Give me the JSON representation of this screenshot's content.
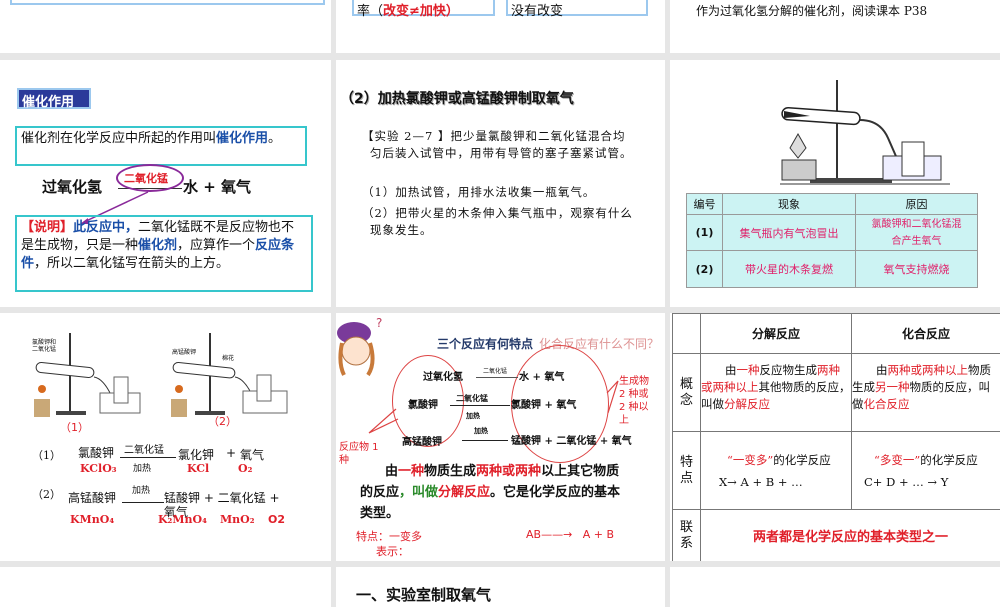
{
  "slides_top": {
    "s2_box1": "率（改变≠加快）",
    "s2_box1_a": "率",
    "s2_box1_b": "（改变≠加快）",
    "s2_box2": "没有改变",
    "s3_text": "作为过氧化氢分解的催化剂，阅读课本 P38"
  },
  "catalysis": {
    "title": "催化作用",
    "def_a": "催化剂在化学反应中所起的作用叫",
    "def_b": "催化作用",
    "def_c": "。",
    "eq_left": "过氧化氢",
    "eq_cond": "二氧化锰",
    "eq_right": "水 + 氧气",
    "note_tag": "【说明】",
    "note_blue1": "此反应中，",
    "note_1": "二氧化锰既不是反应物也不是生成物，只是一种",
    "note_blue2": "催化剂",
    "note_2": "，应算作一个",
    "note_blue3": "反应条件",
    "note_3": "，所以二氧化锰写在箭头的上方。"
  },
  "experiment": {
    "heading": "（2）加热氯酸钾或高锰酸钾制取氧气",
    "p1": "【实验 2—7 】把少量氯酸钾和二氧化锰混合均匀后装入试管中，用带有导管的塞子塞紧试管。",
    "p2": "（1）加热试管，用排水法收集一瓶氧气。",
    "p3": "（2）把带火星的木条伸入集气瓶中，观察有什么现象发生。"
  },
  "results_table": {
    "headers": [
      "编号",
      "现象",
      "原因"
    ],
    "rows": [
      [
        "(1)",
        "集气瓶内有气泡冒出",
        "氯酸钾和二氧化锰混合产生氧气"
      ],
      [
        "(2)",
        "带火星的木条复燃",
        "氧气支持燃烧"
      ]
    ]
  },
  "equations": {
    "label1_img": "氯酸钾和二氧化锰",
    "label2_img": "高锰酸钾",
    "label2_cotton": "棉花",
    "fig1": "（1）",
    "fig2": "（2）",
    "r1_no": "（1）",
    "r1_reactant": "氯酸钾",
    "r1_cond_top": "二氧化锰",
    "r1_cond_bottom": "加热",
    "r1_p1": "氯化钾",
    "r1_plus": "+",
    "r1_p2": "氧气",
    "r1_f_reactant": "KClO₃",
    "r1_f_p1": "KCl",
    "r1_f_p2": "O₂",
    "r2_no": "（2）",
    "r2_reactant": "高锰酸钾",
    "r2_cond": "加热",
    "r2_products": "锰酸钾 + 二氧化锰 + 氧气",
    "r2_f_reactant": "KMnO₄",
    "r2_f_p1": "K₂MnO₄",
    "r2_f_p2": "MnO₂",
    "r2_f_p3": "O2"
  },
  "decomposition": {
    "title_a": "三个反应有何特点",
    "title_b": "化合反应有什么不同？",
    "eq1_l": "过氧化氢",
    "eq1_c": "二氧化锰",
    "eq1_r": "水 + 氧气",
    "eq2_l": "氯酸钾",
    "eq2_c": "二氧化锰",
    "eq2_c2": "加热",
    "eq2_r": "氯酸钾 + 氧气",
    "eq3_l": "高锰酸钾",
    "eq3_c": "加热",
    "eq3_r": "锰酸钾 + 二氧化锰 + 氧气",
    "note_left": "反应物 1 种",
    "note_right": "生成物 2 种或 2 种以上",
    "def_1": "由",
    "def_2": "一种",
    "def_3": "物质生成",
    "def_4": "两种或两种",
    "def_5": "以上其它物质的反应",
    "def_6": "，叫做",
    "def_7": "分解反应",
    "def_8": "。它是化学反应的基本类型。",
    "feature": "特点：一变多",
    "express": "表示：",
    "formula": "AB——→   A + B"
  },
  "compare_table": {
    "headers": [
      "",
      "分解反应",
      "化合反应"
    ],
    "row_labels": [
      "概念",
      "特点",
      "联系"
    ],
    "concept_decomp": [
      "由",
      "一种",
      "反应物生成",
      "两种或两种以上",
      "其他物质的反应，叫做",
      "分解反应"
    ],
    "concept_comb": [
      "由",
      "两种或两种以上",
      "物质生成",
      "另一种",
      "物质的反应，叫做",
      "化合反应"
    ],
    "feature_decomp": [
      "“一变多”",
      "的化学反应",
      "X→  A + B + …"
    ],
    "feature_comb": [
      "“多变一”",
      "的化学反应",
      "C+ D + … → Y"
    ],
    "relation": "两者都是化学反应的基本类型之一"
  },
  "bottom": {
    "heading": "一、实验室制取氧气"
  }
}
